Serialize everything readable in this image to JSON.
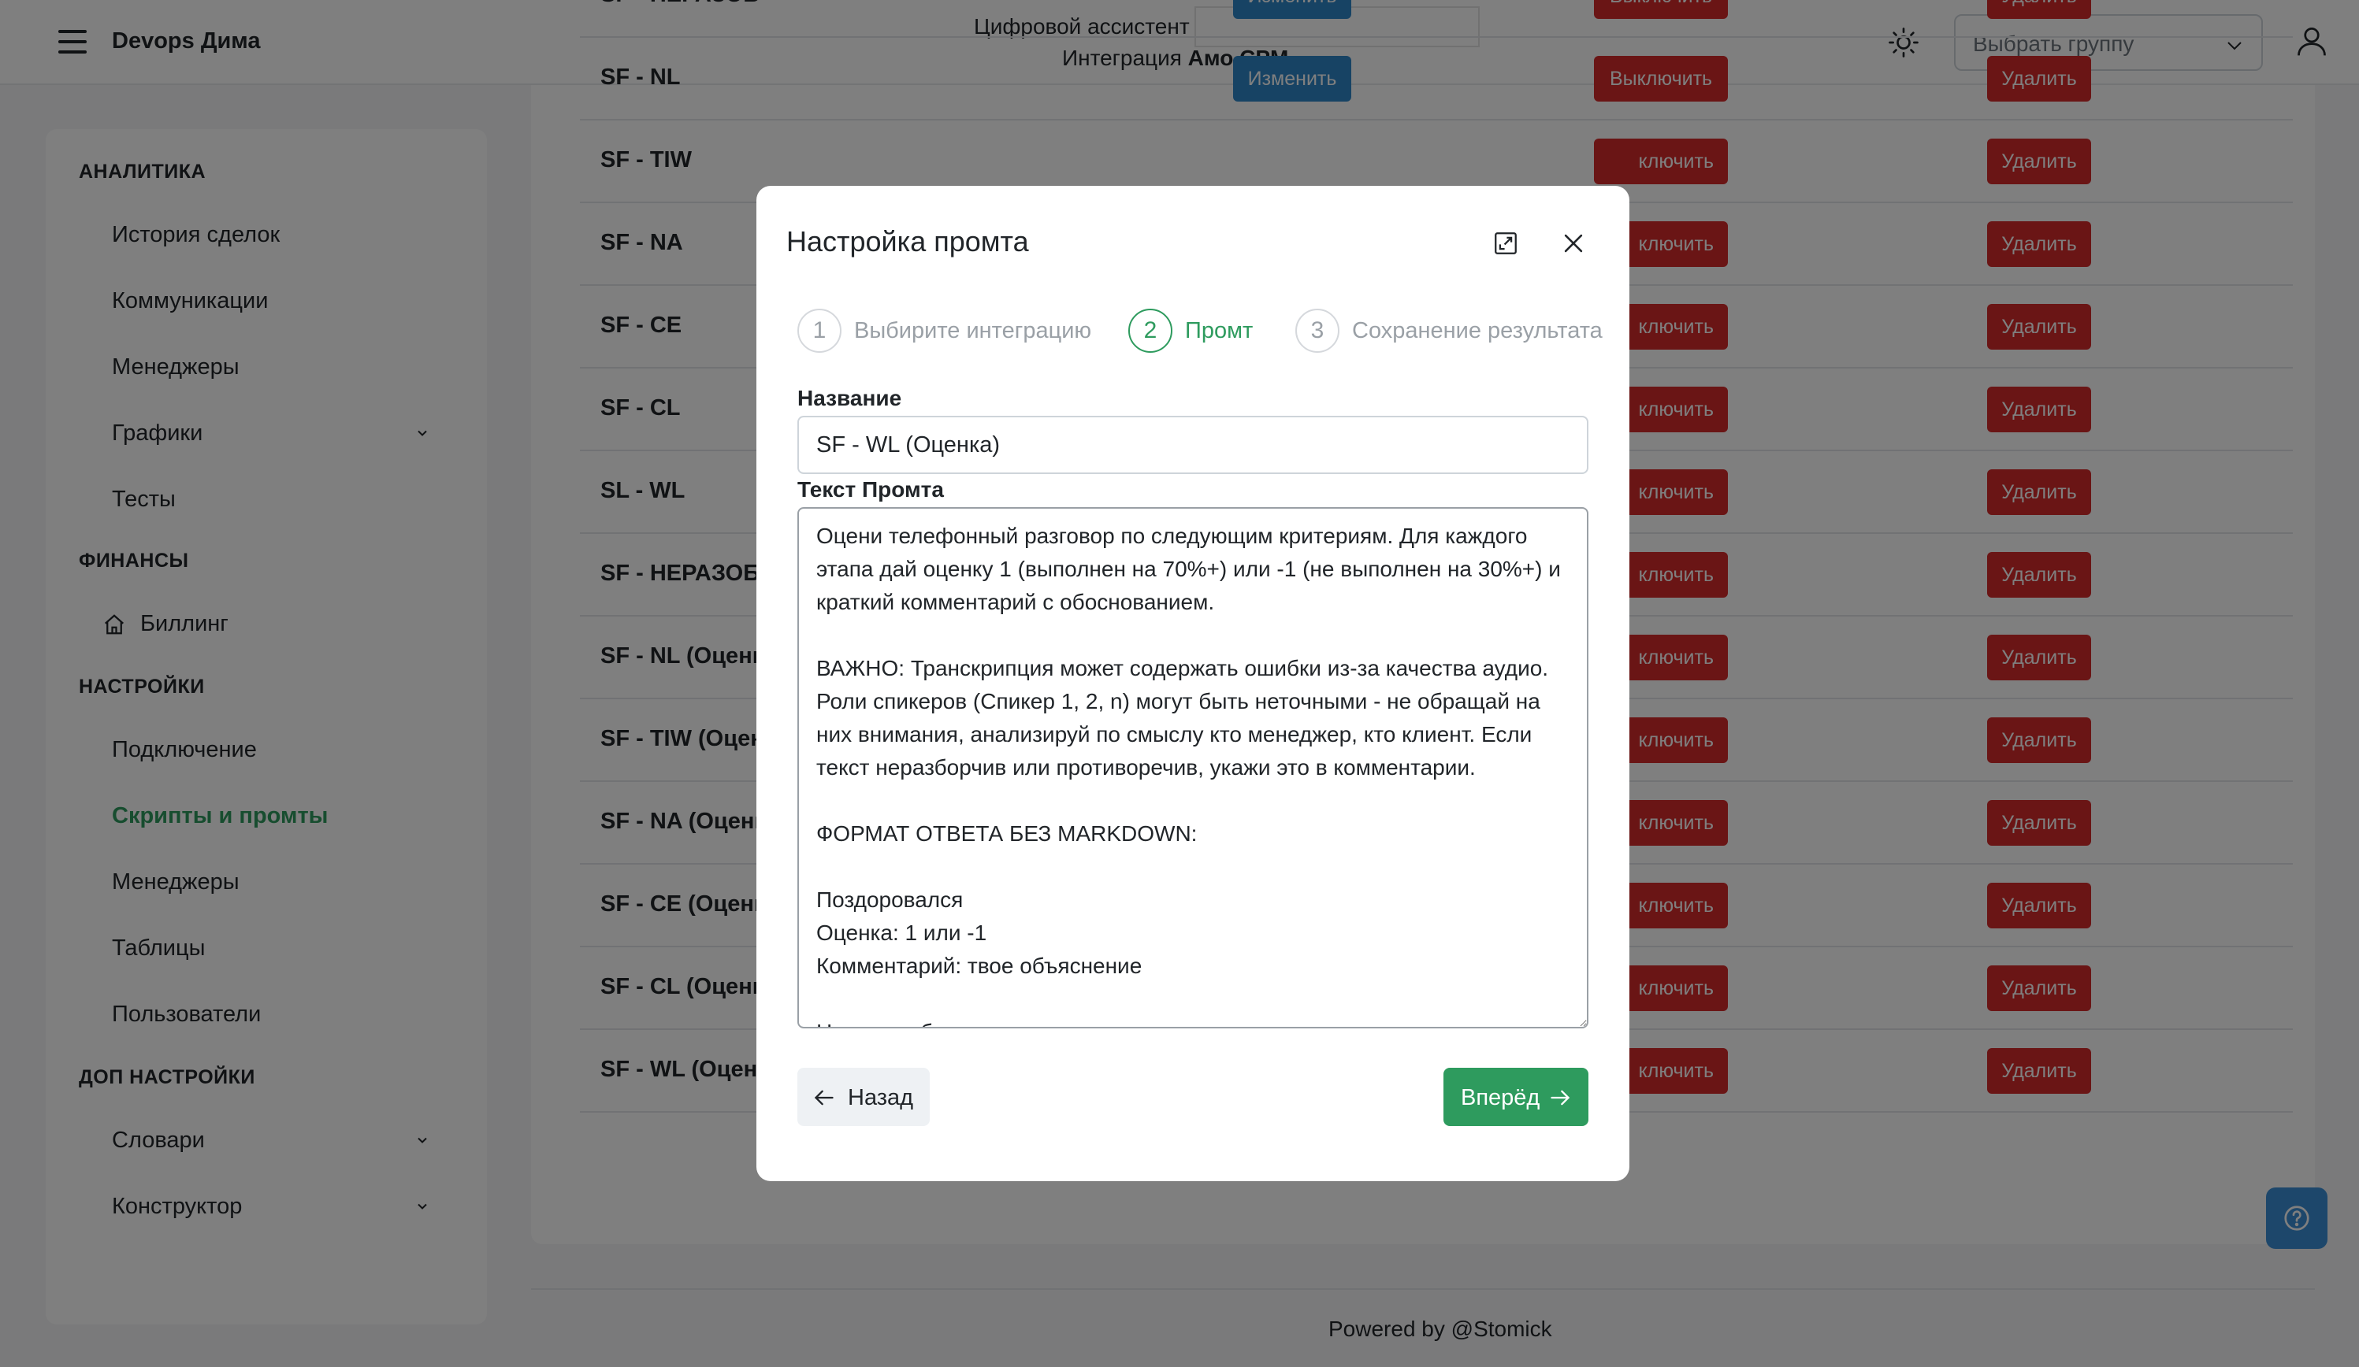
{
  "header": {
    "brand": "Devops Дима",
    "assistant_label": "Цифровой ассистент",
    "integration_prefix": "Интеграция",
    "integration_name": "Амо CPM",
    "group_select_placeholder": "Выбрать группу"
  },
  "sidebar": {
    "sections": [
      {
        "title": "АНАЛИТИКА",
        "items": [
          "История сделок",
          "Коммуникации",
          "Менеджеры",
          "Графики",
          "Тесты"
        ]
      },
      {
        "title": "ФИНАНСЫ",
        "items": [
          "Биллинг"
        ]
      },
      {
        "title": "НАСТРОЙКИ",
        "items": [
          "Подключение",
          "Скрипты и промты",
          "Менеджеры",
          "Таблицы",
          "Пользователи"
        ]
      },
      {
        "title": "ДОП НАСТРОЙКИ",
        "items": [
          "Словари",
          "Конструктор"
        ]
      }
    ],
    "active_item": "Скрипты и промты"
  },
  "table": {
    "rows": [
      "SF - НЕРАЗОБ",
      "SF - NL",
      "SF - TIW",
      "SF - NA",
      "SF - CE",
      "SF - CL",
      "SL - WL",
      "SF - НЕРАЗОБ (",
      "SF - NL (Оценка",
      "SF - TIW (Оцен",
      "SF - NA (Оценка",
      "SF - CE (Оценка",
      "SF - CL (Оценка",
      "SF - WL (Оценк"
    ],
    "edit_label": "Изменить",
    "disable_label": "Выключить",
    "disable_label_clipped": "ключить",
    "delete_label": "Удалить"
  },
  "footer": {
    "text": "Powered by @Stomick"
  },
  "modal": {
    "title": "Настройка промта",
    "steps": [
      {
        "num": "1",
        "label": "Выбирите интеграцию"
      },
      {
        "num": "2",
        "label": "Промт"
      },
      {
        "num": "3",
        "label": "Сохранение результата"
      }
    ],
    "active_step": 2,
    "name_label": "Название",
    "name_value": "SF - WL (Оценка)",
    "prompt_label": "Текст Промта",
    "prompt_text": "Оцени телефонный разговор по следующим критериям. Для каждого этапа дай оценку 1 (выполнен на 70%+) или -1 (не выполнен на 30%+) и краткий комментарий с обоснованием.\n\nВАЖНО: Транскрипция может содержать ошибки из-за качества аудио. Роли спикеров (Спикер 1, 2, n) могут быть неточными - не обращай на них внимания, анализируй по смыслу кто менеджер, кто клиент. Если текст неразборчив или противоречив, укажи это в комментарии.\n\nФОРМАТ ОТВЕТА БЕЗ MARKDOWN:\n\nПоздоровался\nОценка: 1 или -1\nКомментарий: твое объяснение\n\nНазвал себя",
    "back_label": "Назад",
    "next_label": "Вперёд"
  },
  "colors": {
    "accent_green": "#2e9b5e",
    "edit_blue": "#2f86c9",
    "danger_red": "#d42a2a",
    "help_blue": "#3b8fd6"
  }
}
